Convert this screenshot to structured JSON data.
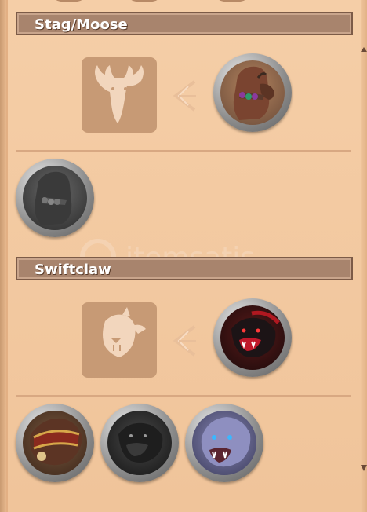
{
  "sections": [
    {
      "title": "Stag/Moose",
      "base_mount_icon": "moose-silhouette-icon",
      "upgrade_icon": "chevron-left-arrow-icon",
      "featured_mount_icon": "armored-moose-mount-icon",
      "variants": [
        "moose-grey-variant-icon"
      ]
    },
    {
      "title": "Swiftclaw",
      "base_mount_icon": "swiftclaw-silhouette-icon",
      "upgrade_icon": "chevron-left-arrow-icon",
      "featured_mount_icon": "red-swiftclaw-mount-icon",
      "variants": [
        "armored-swiftclaw-variant-icon",
        "black-swiftclaw-variant-icon",
        "blue-swiftclaw-variant-icon"
      ]
    }
  ],
  "watermark_text": "itemsatis",
  "colors": {
    "panel": "#f0c49a",
    "header_bg": "#a8846d",
    "tile": "#c79a75",
    "tile_icon": "#f2d6bd"
  }
}
